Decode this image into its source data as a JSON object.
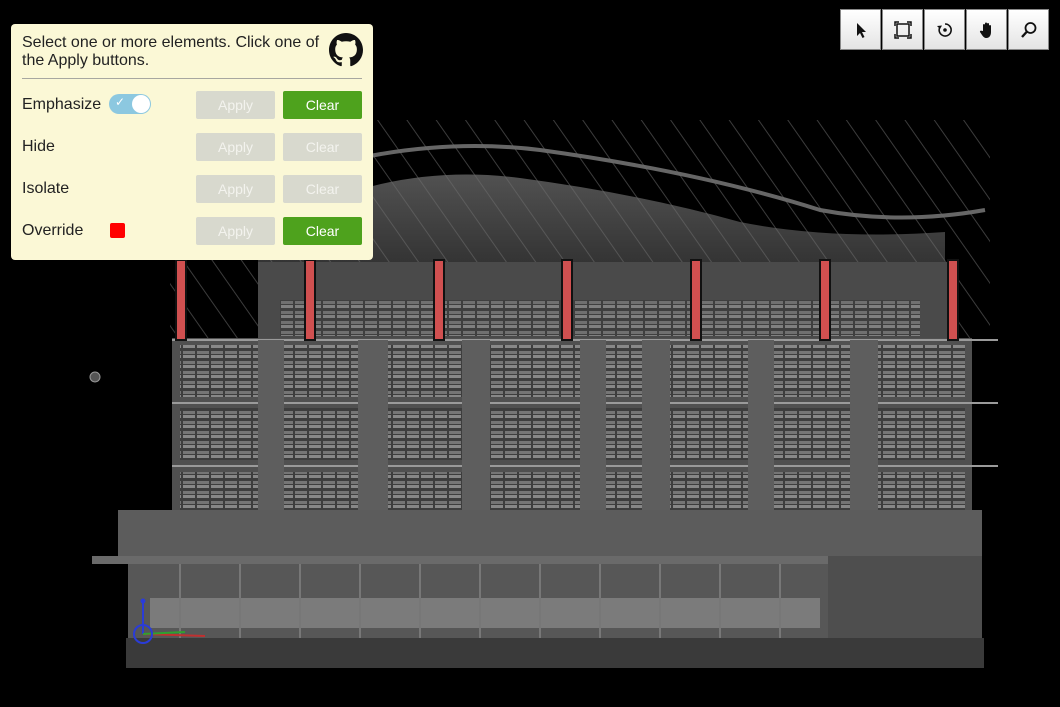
{
  "panel": {
    "instructions": "Select one or more elements. Click one of the Apply buttons.",
    "rows": [
      {
        "label": "Emphasize",
        "apply_label": "Apply",
        "clear_label": "Clear"
      },
      {
        "label": "Hide",
        "apply_label": "Apply",
        "clear_label": "Clear"
      },
      {
        "label": "Isolate",
        "apply_label": "Apply",
        "clear_label": "Clear"
      },
      {
        "label": "Override",
        "apply_label": "Apply",
        "clear_label": "Clear"
      }
    ],
    "emphasize_toggle_on": true,
    "override_color": "#ff0000",
    "github_icon": "github-icon"
  },
  "toolbar": {
    "tools": [
      "select-icon",
      "fit-view-icon",
      "rotate-icon",
      "pan-hand-icon",
      "zoom-icon"
    ]
  },
  "colors": {
    "panel_bg": "#fbf8d6",
    "clear_active": "#4ea21d",
    "button_disabled": "#d8d9ce",
    "highlight_red": "#d05050",
    "toggle_on": "#8cc8e0"
  }
}
